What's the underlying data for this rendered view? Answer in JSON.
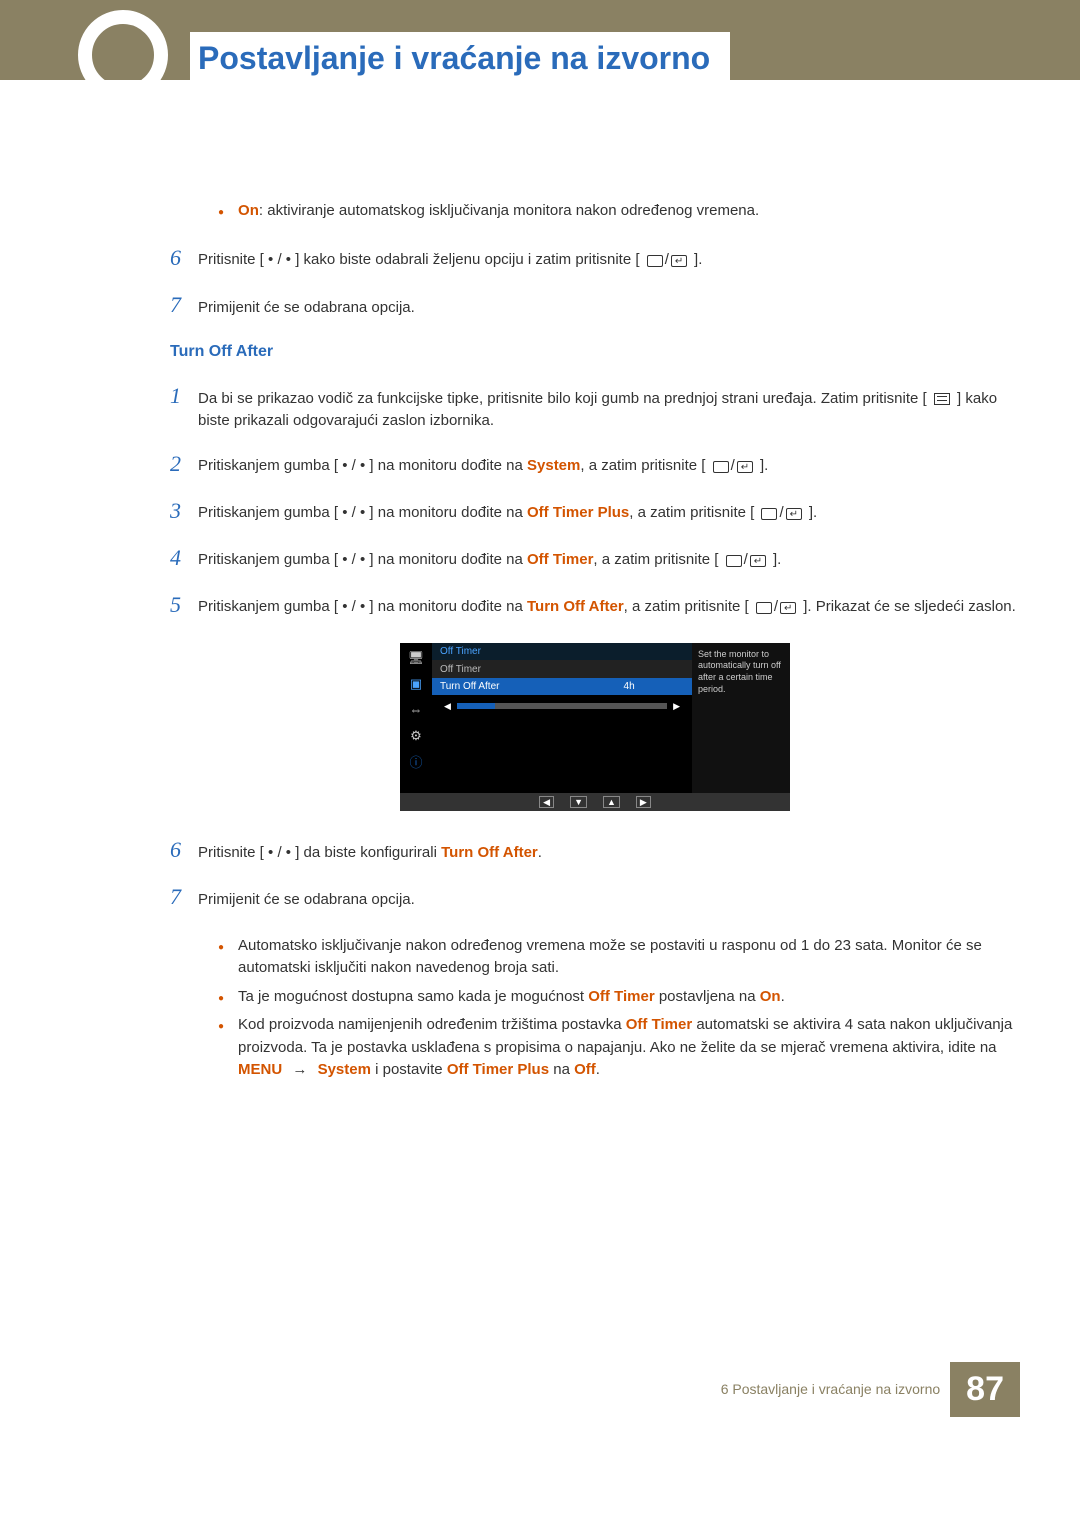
{
  "page_title": "Postavljanje i vraćanje na izvorno",
  "top_bullet": {
    "label": "On",
    "text": ": aktiviranje automatskog isključivanja monitora nakon određenog vremena."
  },
  "steps_a": [
    {
      "n": "6",
      "pre": "Pritisnite [ • / • ] kako biste odabrali željenu opciju i zatim pritisnite [",
      "post": "]."
    },
    {
      "n": "7",
      "pre": "Primijenit će se odabrana opcija.",
      "post": ""
    }
  ],
  "section_title": "Turn Off After",
  "steps_b": [
    {
      "n": "1",
      "text_a": "Da bi se prikazao vodič za funkcijske tipke, pritisnite bilo koji gumb na prednjoj strani uređaja. Zatim pritisnite [",
      "text_b": "] kako biste prikazali odgovarajući zaslon izbornika.",
      "icon": "menu"
    },
    {
      "n": "2",
      "text_a": "Pritiskanjem gumba [ • / • ] na monitoru dođite na ",
      "hl": "System",
      "text_b": ", a zatim pritisnite [",
      "text_c": "].",
      "icon": "combo"
    },
    {
      "n": "3",
      "text_a": "Pritiskanjem gumba [ • / • ] na monitoru dođite na ",
      "hl": "Off Timer Plus",
      "text_b": ", a zatim pritisnite [",
      "text_c": "].",
      "icon": "combo"
    },
    {
      "n": "4",
      "text_a": "Pritiskanjem gumba [ • / • ] na monitoru dođite na ",
      "hl": "Off Timer",
      "text_b": ", a zatim pritisnite [",
      "text_c": "].",
      "icon": "combo"
    },
    {
      "n": "5",
      "text_a": "Pritiskanjem gumba [ • / • ] na monitoru dođite na ",
      "hl": "Turn Off After",
      "text_b": ", a zatim pritisnite [",
      "text_c": "]. Prikazat će se sljedeći zaslon.",
      "icon": "combo"
    }
  ],
  "osd": {
    "header": "Off Timer",
    "sub": "Off Timer",
    "selected_label": "Turn Off After",
    "selected_value": "4h",
    "desc": "Set the monitor to automatically turn off after a certain time period."
  },
  "steps_c": [
    {
      "n": "6",
      "pre": "Pritisnite [ • / • ] da biste konfigurirali ",
      "hl": "Turn Off After",
      "post": "."
    },
    {
      "n": "7",
      "pre": "Primijenit će se odabrana opcija.",
      "hl": "",
      "post": ""
    }
  ],
  "notes": [
    {
      "text": "Automatsko isključivanje nakon određenog vremena može se postaviti u rasponu od 1 do 23 sata. Monitor će se automatski isključiti nakon navedenog broja sati."
    },
    {
      "pre": "Ta je mogućnost dostupna samo kada je mogućnost ",
      "hl1": "Off Timer",
      "mid": " postavljena na ",
      "hl2": "On",
      "post": "."
    },
    {
      "pre": "Kod proizvoda namijenjenih određenim tržištima postavka ",
      "hl1": "Off Timer",
      "mid": " automatski se aktivira 4 sata nakon uključivanja proizvoda. Ta je postavka usklađena s propisima o napajanju. Ako ne želite da se mjerač vremena aktivira, idite na ",
      "hl2": "MENU",
      "arrow": " → ",
      "hl3": "System",
      "mid2": " i postavite ",
      "hl4": "Off Timer Plus",
      "mid3": " na ",
      "hl5": "Off",
      "post": "."
    }
  ],
  "footer": {
    "chapter": "6 Postavljanje i vraćanje na izvorno",
    "page": "87"
  }
}
